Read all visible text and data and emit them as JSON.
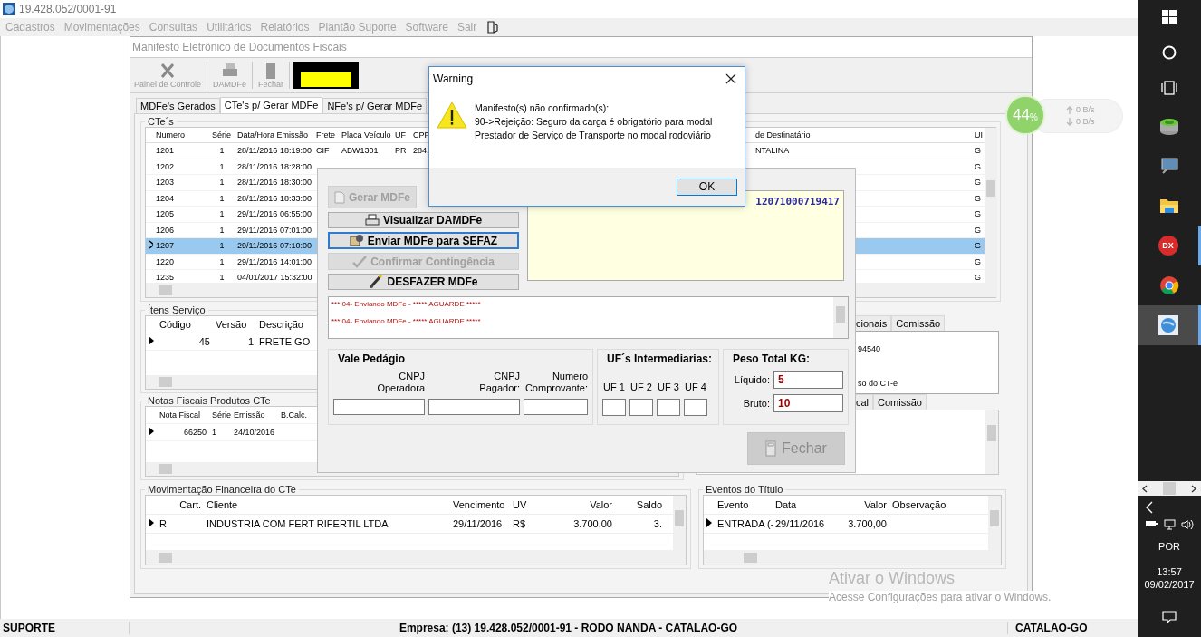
{
  "app": {
    "title": "19.428.052/0001-91"
  },
  "menu": [
    {
      "label": "Cadastros",
      "disabled": true
    },
    {
      "label": "Movimentações",
      "disabled": true
    },
    {
      "label": "Consultas",
      "disabled": true
    },
    {
      "label": "Utilitários",
      "disabled": true
    },
    {
      "label": "Relatórios",
      "disabled": true
    },
    {
      "label": "Plantão Suporte",
      "disabled": true
    },
    {
      "label": "Software",
      "disabled": true
    },
    {
      "label": "Sair",
      "disabled": true
    }
  ],
  "window": {
    "title": "Manifesto Eletrônico de Documentos Fiscais"
  },
  "toolbar": [
    {
      "label": "Painel de Controle",
      "kind": "tools",
      "disabled": true
    },
    {
      "label": "DAMDFe",
      "kind": "printer",
      "disabled": true
    },
    {
      "label": "Fechar",
      "kind": "door",
      "disabled": true
    }
  ],
  "tabs": [
    {
      "label": "MDFe's Gerados",
      "selected": false
    },
    {
      "label": "CTe's p/ Gerar MDFe",
      "selected": true
    },
    {
      "label": "NFe's p/ Gerar MDFe",
      "selected": false
    }
  ],
  "ctes": {
    "title": "CTe´s",
    "columns": [
      "Numero",
      "Série",
      "Data/Hora Emissão",
      "Frete",
      "Placa Veículo",
      "UF",
      "CPF"
    ],
    "right_columns": [
      "de Destinatário",
      "UI"
    ],
    "rows": [
      {
        "numero": "1201",
        "serie": "1",
        "emissao": "28/11/2016 18:19:00",
        "frete": "CIF",
        "placa": "ABW1301",
        "uf": "PR",
        "cpf": "284.",
        "destinatario": "NTALINA",
        "ui": "G",
        "selected": false
      },
      {
        "numero": "1202",
        "serie": "1",
        "emissao": "28/11/2016 18:28:00",
        "ui": "G",
        "selected": false
      },
      {
        "numero": "1203",
        "serie": "1",
        "emissao": "28/11/2016 18:30:00",
        "ui": "G",
        "selected": false
      },
      {
        "numero": "1204",
        "serie": "1",
        "emissao": "28/11/2016 18:33:00",
        "ui": "G",
        "selected": false
      },
      {
        "numero": "1205",
        "serie": "1",
        "emissao": "29/11/2016 06:55:00",
        "ui": "G",
        "selected": false
      },
      {
        "numero": "1206",
        "serie": "1",
        "emissao": "29/11/2016 07:01:00",
        "ui": "G",
        "selected": false
      },
      {
        "numero": "1207",
        "serie": "1",
        "emissao": "29/11/2016 07:10:00",
        "ui": "G",
        "selected": true
      },
      {
        "numero": "1220",
        "serie": "1",
        "emissao": "29/11/2016 14:01:00",
        "ui": "G",
        "selected": false
      },
      {
        "numero": "1235",
        "serie": "1",
        "emissao": "04/01/2017 15:32:00",
        "ui": "G",
        "selected": false
      }
    ]
  },
  "services": {
    "title": "Ítens Serviço",
    "columns": [
      "Código",
      "Versão",
      "Descrição"
    ],
    "rows": [
      {
        "codigo": "45",
        "versao": "1",
        "descricao": "FRETE GO"
      }
    ]
  },
  "notas": {
    "title": "Notas Fiscais Produtos CTe",
    "columns": [
      "Nota Fiscal",
      "Série",
      "Emissão",
      "B.Calc."
    ],
    "rows": [
      {
        "nota": "66250",
        "serie": "1",
        "emissao": "24/10/2016"
      }
    ]
  },
  "detail_tabs": [
    {
      "label": "cionais",
      "selected": false
    },
    {
      "label": "Comissão",
      "selected": false
    }
  ],
  "detail_texts": [
    "94540",
    "so do CT-e"
  ],
  "detail_tabs_2": [
    {
      "label": "cal",
      "selected": false
    },
    {
      "label": "Comissão",
      "selected": false
    }
  ],
  "financeiro": {
    "title": "Movimentação Financeira do CTe",
    "columns": [
      "Cart.",
      "Cliente",
      "Vencimento",
      "UV",
      "Valor",
      "Saldo"
    ],
    "rows": [
      {
        "cart": "R",
        "cliente": "INDUSTRIA COM FERT RIFERTIL LTDA",
        "vencimento": "29/11/2016",
        "uv": "R$",
        "valor": "3.700,00",
        "saldo": "3."
      }
    ]
  },
  "eventos": {
    "title": "Eventos do Título",
    "columns": [
      "Evento",
      "Data",
      "Valor",
      "Observação"
    ],
    "rows": [
      {
        "evento": "ENTRADA (-",
        "data": "29/11/2016",
        "valor": "3.700,00"
      }
    ]
  },
  "panel": {
    "buttons": [
      {
        "label": "Gerar MDFe",
        "kind": "document",
        "disabled": true,
        "focused": false
      },
      {
        "label": "Visualizar DAMDFe",
        "kind": "printer",
        "disabled": false,
        "focused": false
      },
      {
        "label": "Enviar MDFe para SEFAZ",
        "kind": "send",
        "disabled": false,
        "focused": true
      },
      {
        "label": "Confirmar Contingência",
        "kind": "check",
        "disabled": true,
        "focused": false
      },
      {
        "label": "DESFAZER MDFe",
        "kind": "undo",
        "disabled": false,
        "focused": false
      }
    ],
    "key_text": "12071000719417",
    "log": [
      "*** 04- Enviando MDFe - ***** AGUARDE *****",
      "*** 04- Enviando MDFe - ***** AGUARDE *****"
    ],
    "vale_pedagio": {
      "title": "Vale Pedágio",
      "fields": [
        "CNPJ\nOperadora",
        "CNPJ\nPagador:",
        "Numero\nComprovante:"
      ]
    },
    "ufs": {
      "title": "UF´s Intermediarias:",
      "fields": [
        "UF 1",
        "UF 2",
        "UF 3",
        "UF 4"
      ]
    },
    "peso": {
      "title": "Peso Total KG:",
      "fields": [
        {
          "label": "Líquido:",
          "value": "5"
        },
        {
          "label": "Bruto:",
          "value": "10"
        }
      ]
    },
    "close_button": {
      "label": "Fechar",
      "disabled": true
    }
  },
  "warning": {
    "title": "Warning",
    "message": "Manifesto(s) não confirmado(s):\n90->Rejeição: Seguro da carga é obrigatório para modal\nPrestador de Serviço de Transporte no modal rodoviário",
    "button": "OK"
  },
  "net_meter": {
    "percent": "44",
    "unit": "%",
    "up": "0 B/s",
    "down": "0 B/s"
  },
  "activation": {
    "title": "Ativar o Windows",
    "text": "Acesse Configurações para ativar o Windows."
  },
  "status_bar": [
    "SUPORTE",
    "Empresa: (13) 19.428.052/0001-91 - RODO NANDA - CATALAO-GO",
    "CATALAO-GO"
  ],
  "taskbar": {
    "apps": [
      {
        "kind": "database",
        "running": false,
        "active": false
      },
      {
        "kind": "monitor",
        "running": false,
        "active": false
      },
      {
        "kind": "folder",
        "running": false,
        "active": false
      },
      {
        "kind": "dx",
        "label": "DX",
        "running": true,
        "active": false
      },
      {
        "kind": "chrome",
        "running": false,
        "active": false
      },
      {
        "kind": "globe",
        "running": true,
        "active": true
      }
    ],
    "language": "POR",
    "time": "13:57",
    "date": "09/02/2017"
  }
}
